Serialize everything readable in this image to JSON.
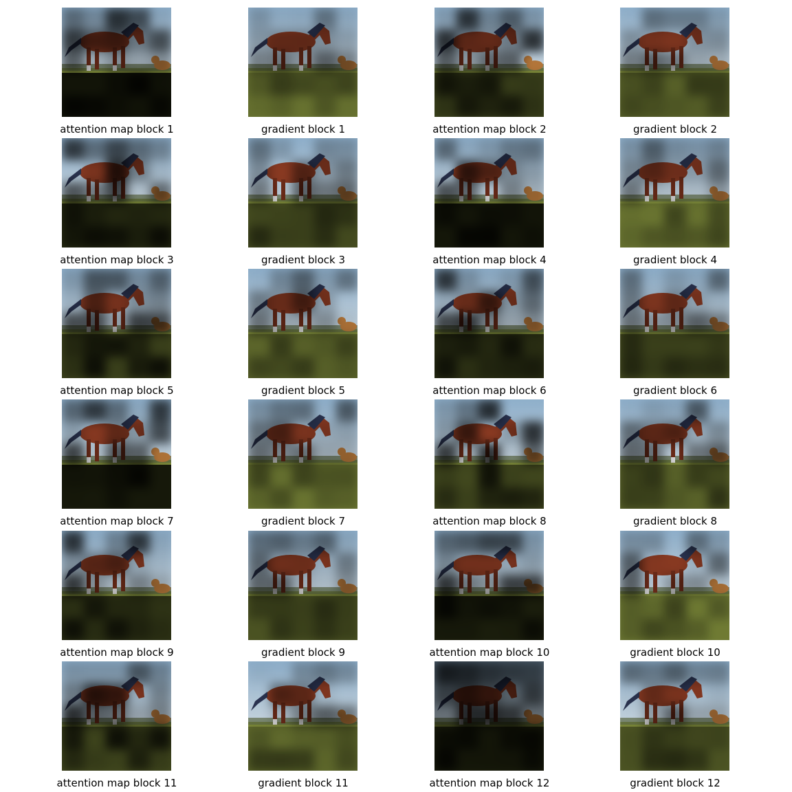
{
  "figure": {
    "panels": [
      {
        "caption": "attention map block 1",
        "kind": "attention",
        "block": 1
      },
      {
        "caption": "gradient block 1",
        "kind": "gradient",
        "block": 1
      },
      {
        "caption": "attention map block 2",
        "kind": "attention",
        "block": 2
      },
      {
        "caption": "gradient block 2",
        "kind": "gradient",
        "block": 2
      },
      {
        "caption": "attention map block 3",
        "kind": "attention",
        "block": 3
      },
      {
        "caption": "gradient block 3",
        "kind": "gradient",
        "block": 3
      },
      {
        "caption": "attention map block 4",
        "kind": "attention",
        "block": 4
      },
      {
        "caption": "gradient block 4",
        "kind": "gradient",
        "block": 4
      },
      {
        "caption": "attention map block 5",
        "kind": "attention",
        "block": 5
      },
      {
        "caption": "gradient block 5",
        "kind": "gradient",
        "block": 5
      },
      {
        "caption": "attention map block 6",
        "kind": "attention",
        "block": 6
      },
      {
        "caption": "gradient block 6",
        "kind": "gradient",
        "block": 6
      },
      {
        "caption": "attention map block 7",
        "kind": "attention",
        "block": 7
      },
      {
        "caption": "gradient block 7",
        "kind": "gradient",
        "block": 7
      },
      {
        "caption": "attention map block 8",
        "kind": "attention",
        "block": 8
      },
      {
        "caption": "gradient block 8",
        "kind": "gradient",
        "block": 8
      },
      {
        "caption": "attention map block 9",
        "kind": "attention",
        "block": 9
      },
      {
        "caption": "gradient block 9",
        "kind": "gradient",
        "block": 9
      },
      {
        "caption": "attention map block 10",
        "kind": "attention",
        "block": 10
      },
      {
        "caption": "gradient block 10",
        "kind": "gradient",
        "block": 10
      },
      {
        "caption": "attention map block 11",
        "kind": "attention",
        "block": 11
      },
      {
        "caption": "gradient block 11",
        "kind": "gradient",
        "block": 11
      },
      {
        "caption": "attention map block 12",
        "kind": "attention",
        "block": 12
      },
      {
        "caption": "gradient block 12",
        "kind": "gradient",
        "block": 12
      }
    ],
    "colors": {
      "sky": "#8fb0cc",
      "grass": "#7d8a3a",
      "horse": "#8a3a22",
      "mane": "#2a3350",
      "dog": "#b5773a",
      "caption_text": "#000000"
    }
  }
}
